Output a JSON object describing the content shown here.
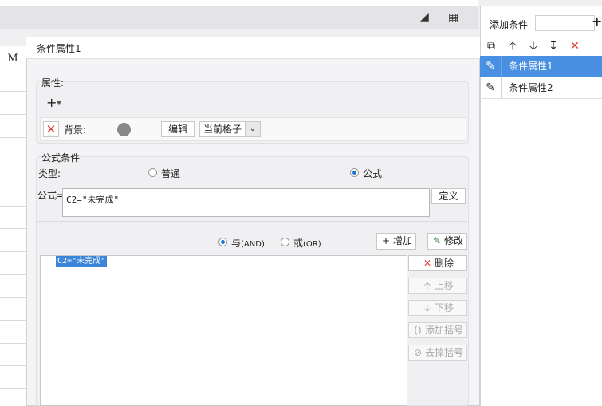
{
  "background": {
    "column_header": "M"
  },
  "right_panel": {
    "add_condition_label": "添加条件",
    "add_icon": "plus-icon",
    "items": [
      {
        "label": "条件属性1",
        "selected": true
      },
      {
        "label": "条件属性2",
        "selected": false
      }
    ]
  },
  "dialog": {
    "title": "条件属性1",
    "attribute_section_label": "属性",
    "background_label": "背景",
    "edit_button": "编辑",
    "scope_select_value": "当前格子",
    "formula_condition_label": "公式条件",
    "type_label": "类型",
    "type_options": [
      {
        "label": "普通",
        "selected": false
      },
      {
        "label": "公式",
        "selected": true
      }
    ],
    "formula_label": "公式=",
    "formula_value": "C2=\"未完成\"",
    "define_button": "定义",
    "logic_options": [
      {
        "label": "与",
        "suffix": "(AND)",
        "selected": true
      },
      {
        "label": "或",
        "suffix": "(OR)",
        "selected": false
      }
    ],
    "add_button": "增加",
    "modify_button": "修改",
    "condition_tree": [
      {
        "label": "C2=\"未完成\"",
        "selected": true
      }
    ],
    "side_buttons": {
      "delete": "删除",
      "move_up": "上移",
      "move_down": "下移",
      "add_paren": "添加括号",
      "remove_paren": "去掉括号"
    }
  },
  "colors": {
    "selection_blue": "#4a90e2",
    "delete_red": "#e53935",
    "swatch_gray": "#888888"
  }
}
